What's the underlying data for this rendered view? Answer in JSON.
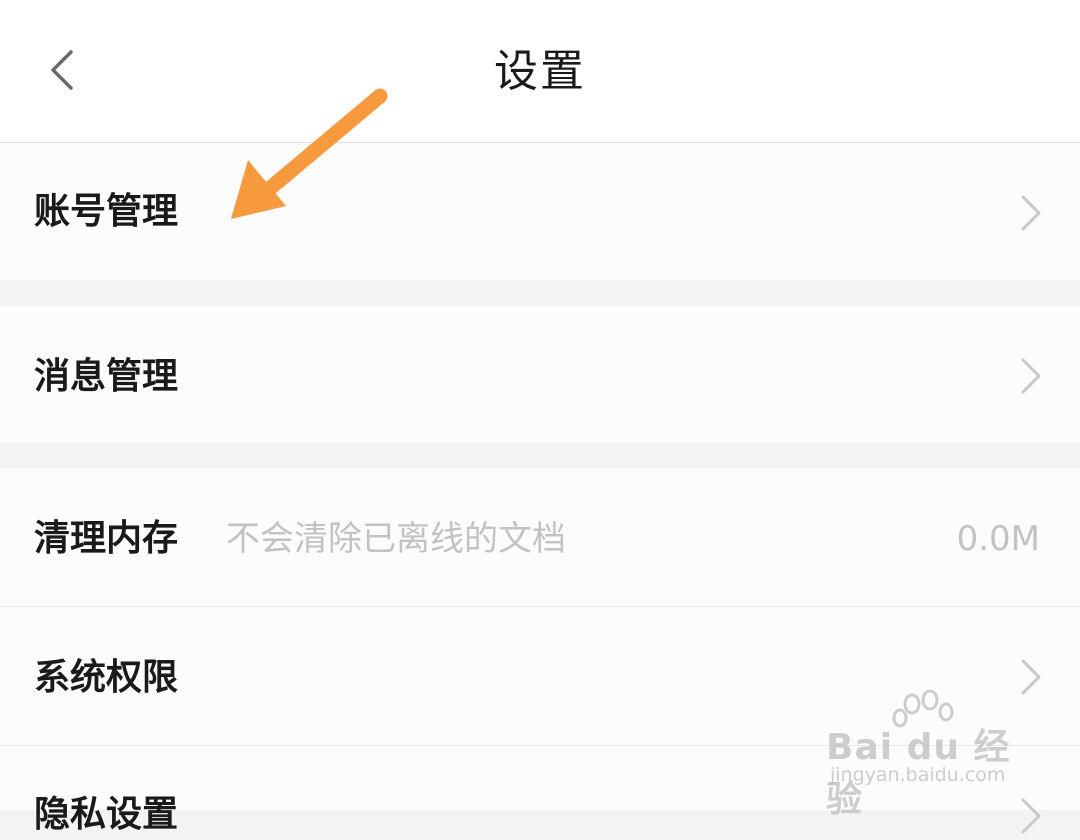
{
  "header": {
    "title": "设置",
    "back_icon": "chevron-left-icon"
  },
  "settings": {
    "account_management": {
      "label": "账号管理"
    },
    "message_management": {
      "label": "消息管理"
    },
    "clear_cache": {
      "label": "清理内存",
      "description": "不会清除已离线的文档",
      "value": "0.0M"
    },
    "system_permissions": {
      "label": "系统权限"
    },
    "privacy_settings": {
      "label": "隐私设置"
    }
  },
  "annotation": {
    "arrow_color": "#f79a3e"
  },
  "watermark": {
    "brand": "Bai du 经验",
    "url": "jingyan.baidu.com"
  }
}
